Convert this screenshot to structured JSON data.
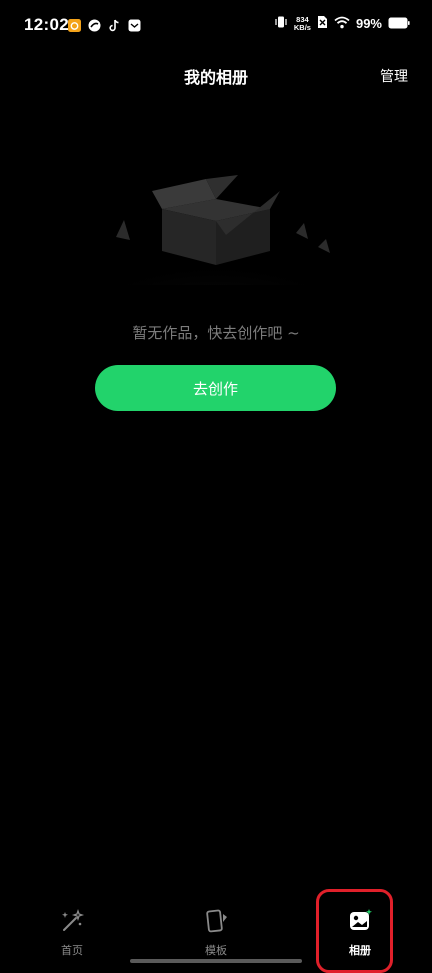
{
  "status_bar": {
    "time": "12:02",
    "net_speed_value": "834",
    "net_speed_unit": "KB/s",
    "battery": "99%",
    "notification_icons": [
      "weibo-icon",
      "app-icon",
      "tiktok-icon",
      "message-icon"
    ]
  },
  "header": {
    "title": "我的相册",
    "manage_label": "管理"
  },
  "empty_state": {
    "message": "暂无作品，快去创作吧 ~",
    "create_button_label": "去创作"
  },
  "bottom_nav": {
    "items": [
      {
        "label": "首页",
        "icon": "magic-wand-icon",
        "active": false
      },
      {
        "label": "模板",
        "icon": "template-card-icon",
        "active": false
      },
      {
        "label": "相册",
        "icon": "album-icon",
        "active": true
      }
    ]
  },
  "colors": {
    "background": "#000000",
    "accent": "#22d36b",
    "highlight": "#e0202a",
    "muted_text": "#7d7d7d"
  }
}
